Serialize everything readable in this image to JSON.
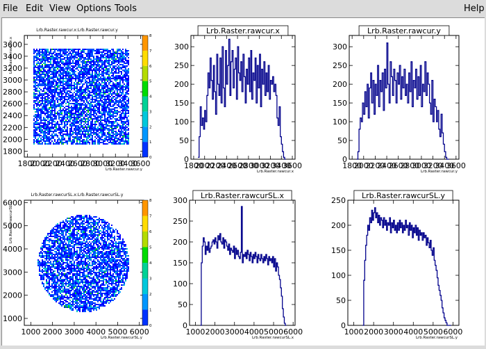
{
  "menubar": {
    "file": "File",
    "edit": "Edit",
    "view": "View",
    "options": "Options",
    "tools": "Tools",
    "help": "Help"
  },
  "colors": {
    "hist_line": "#00008b",
    "palette": [
      "#3c00c8",
      "#0032ff",
      "#0096ff",
      "#00c8dc",
      "#00d296",
      "#00dc00",
      "#b4dc00",
      "#ffdc00",
      "#ff9600",
      "#ff0000"
    ]
  },
  "chart_data": [
    {
      "id": "p1",
      "type": "heatmap",
      "title": "Lrb.Raster.rawcur.x:Lrb.Raster.rawcur.y",
      "xlabel": "Lrb.Raster.rawcur.y",
      "ylabel": "Lrb.Raster.rawcur.x",
      "xlim": [
        1750,
        3650
      ],
      "ylim": [
        1700,
        3750
      ],
      "xticks": [
        1800,
        2000,
        2200,
        2400,
        2600,
        2800,
        3000,
        3200,
        3400,
        3600
      ],
      "yticks": [
        1800,
        2000,
        2200,
        2400,
        2600,
        2800,
        3000,
        3200,
        3400,
        3600
      ],
      "xtick_labels": [
        "1800",
        "2000",
        "2200",
        "2400",
        "2600",
        "2800",
        "3000",
        "3200",
        "3400",
        "3600"
      ],
      "ytick_labels": [
        "1800",
        "2000",
        "2200",
        "2400",
        "2600",
        "2800",
        "3000",
        "3200",
        "3400",
        "3600"
      ],
      "zlim": [
        0,
        8
      ],
      "zticks": [
        0,
        1,
        2,
        3,
        4,
        5,
        6,
        7,
        8
      ],
      "zlabels": [
        "0",
        "1",
        "2",
        "3",
        "4",
        "5",
        "6",
        "7",
        "8"
      ],
      "shape": "square",
      "region_x": [
        1880,
        3400
      ],
      "region_y": [
        1920,
        3540
      ]
    },
    {
      "id": "p2",
      "type": "line",
      "title": "Lrb.Raster.rawcur.x",
      "xlabel": "Lrb.Raster.rawcur.x",
      "xlim": [
        1750,
        3650
      ],
      "ylim": [
        0,
        330
      ],
      "xticks": [
        1800,
        2000,
        2200,
        2400,
        2600,
        2800,
        3000,
        3200,
        3400,
        3600
      ],
      "xtick_labels": [
        "1800",
        "2000",
        "2200",
        "2400",
        "2600",
        "2800",
        "3000",
        "3200",
        "3400",
        "3600"
      ],
      "yticks": [
        0,
        50,
        100,
        150,
        200,
        250,
        300
      ],
      "ytick_labels": [
        "0",
        "50",
        "100",
        "150",
        "200",
        "250",
        "300"
      ],
      "x": [
        1880,
        1900,
        1920,
        1940,
        1960,
        1980,
        2000,
        2020,
        2040,
        2060,
        2080,
        2100,
        2120,
        2140,
        2160,
        2180,
        2200,
        2220,
        2240,
        2260,
        2280,
        2300,
        2320,
        2340,
        2360,
        2380,
        2400,
        2420,
        2440,
        2460,
        2480,
        2500,
        2520,
        2540,
        2560,
        2580,
        2600,
        2620,
        2640,
        2660,
        2680,
        2700,
        2720,
        2740,
        2760,
        2780,
        2800,
        2820,
        2840,
        2860,
        2880,
        2900,
        2920,
        2940,
        2960,
        2980,
        3000,
        3020,
        3040,
        3060,
        3080,
        3100,
        3120,
        3140,
        3160,
        3180,
        3200,
        3220,
        3240,
        3260,
        3280,
        3300,
        3320,
        3340,
        3360,
        3380,
        3400,
        3420,
        3440,
        3460
      ],
      "y": [
        5,
        60,
        140,
        90,
        110,
        80,
        130,
        100,
        170,
        230,
        190,
        270,
        210,
        160,
        250,
        180,
        120,
        280,
        200,
        170,
        270,
        150,
        300,
        190,
        140,
        290,
        200,
        250,
        320,
        170,
        260,
        290,
        190,
        240,
        270,
        160,
        300,
        230,
        210,
        260,
        180,
        280,
        220,
        150,
        240,
        200,
        270,
        180,
        290,
        160,
        230,
        210,
        270,
        150,
        250,
        190,
        280,
        140,
        240,
        200,
        260,
        170,
        230,
        180,
        250,
        160,
        210,
        200,
        220,
        180,
        200,
        170,
        110,
        90,
        140,
        60,
        40,
        20,
        5,
        0
      ]
    },
    {
      "id": "p3",
      "type": "line",
      "title": "Lrb.Raster.rawcur.y",
      "xlabel": "Lrb.Raster.rawcur.y",
      "xlim": [
        1750,
        3650
      ],
      "ylim": [
        0,
        330
      ],
      "xticks": [
        1800,
        2000,
        2200,
        2400,
        2600,
        2800,
        3000,
        3200,
        3400,
        3600
      ],
      "xtick_labels": [
        "1800",
        "2000",
        "2200",
        "2400",
        "2600",
        "2800",
        "3000",
        "3200",
        "3400",
        "3600"
      ],
      "yticks": [
        0,
        50,
        100,
        150,
        200,
        250,
        300
      ],
      "ytick_labels": [
        "0",
        "50",
        "100",
        "150",
        "200",
        "250",
        "300"
      ],
      "x": [
        1880,
        1900,
        1920,
        1940,
        1960,
        1980,
        2000,
        2020,
        2040,
        2060,
        2080,
        2100,
        2120,
        2140,
        2160,
        2180,
        2200,
        2220,
        2240,
        2260,
        2280,
        2300,
        2320,
        2340,
        2360,
        2380,
        2400,
        2420,
        2440,
        2460,
        2480,
        2500,
        2520,
        2540,
        2560,
        2580,
        2600,
        2620,
        2640,
        2660,
        2680,
        2700,
        2720,
        2740,
        2760,
        2780,
        2800,
        2820,
        2840,
        2860,
        2880,
        2900,
        2920,
        2940,
        2960,
        2980,
        3000,
        3020,
        3040,
        3060,
        3080,
        3100,
        3120,
        3140,
        3160,
        3180,
        3200,
        3220,
        3240,
        3260,
        3280,
        3300,
        3320,
        3340,
        3360,
        3380,
        3400,
        3420,
        3440,
        3460
      ],
      "y": [
        0,
        20,
        80,
        110,
        100,
        150,
        120,
        180,
        140,
        200,
        110,
        190,
        230,
        150,
        210,
        120,
        200,
        170,
        250,
        140,
        210,
        180,
        230,
        130,
        240,
        190,
        310,
        200,
        150,
        260,
        220,
        170,
        240,
        210,
        150,
        230,
        200,
        250,
        160,
        220,
        190,
        240,
        170,
        200,
        150,
        230,
        180,
        260,
        140,
        210,
        190,
        240,
        160,
        220,
        170,
        250,
        140,
        200,
        180,
        260,
        170,
        230,
        200,
        150,
        120,
        210,
        100,
        160,
        140,
        100,
        130,
        80,
        60,
        120,
        70,
        40,
        20,
        5,
        0,
        0
      ]
    },
    {
      "id": "p4",
      "type": "heatmap",
      "title": "Lrb.Raster.rawcurSL.x:Lrb.Raster.rawcurSL.y",
      "xlabel": "Lrb.Raster.rawcurSL.y",
      "ylabel": "Lrb.Raster.rawcurSL.x",
      "xlim": [
        700,
        6200
      ],
      "ylim": [
        700,
        6100
      ],
      "xticks": [
        1000,
        2000,
        3000,
        4000,
        5000,
        6000
      ],
      "yticks": [
        1000,
        2000,
        3000,
        4000,
        5000,
        6000
      ],
      "xtick_labels": [
        "1000",
        "2000",
        "3000",
        "4000",
        "5000",
        "6000"
      ],
      "ytick_labels": [
        "1000",
        "2000",
        "3000",
        "4000",
        "5000",
        "6000"
      ],
      "zlim": [
        0,
        8
      ],
      "zticks": [
        0,
        1,
        2,
        3,
        4,
        5,
        6,
        7,
        8
      ],
      "zlabels": [
        "0",
        "1",
        "2",
        "3",
        "4",
        "5",
        "6",
        "7",
        "8"
      ],
      "shape": "circle",
      "center": [
        3400,
        3400
      ],
      "radius": 2100
    },
    {
      "id": "p5",
      "type": "line",
      "title": "Lrb.Raster.rawcurSL.x",
      "xlabel": "Lrb.Raster.rawcurSL.x",
      "xlim": [
        700,
        6100
      ],
      "ylim": [
        0,
        300
      ],
      "xticks": [
        1000,
        2000,
        3000,
        4000,
        5000,
        6000
      ],
      "xtick_labels": [
        "1000",
        "2000",
        "3000",
        "4000",
        "5000",
        "6000"
      ],
      "yticks": [
        0,
        50,
        100,
        150,
        200,
        250,
        300
      ],
      "ytick_labels": [
        "0",
        "50",
        "100",
        "150",
        "200",
        "250",
        "300"
      ],
      "x": [
        1250,
        1300,
        1350,
        1400,
        1450,
        1500,
        1550,
        1600,
        1650,
        1700,
        1750,
        1800,
        1850,
        1900,
        1950,
        2000,
        2050,
        2100,
        2150,
        2200,
        2250,
        2300,
        2350,
        2400,
        2450,
        2500,
        2550,
        2600,
        2650,
        2700,
        2750,
        2800,
        2850,
        2900,
        2950,
        3000,
        3050,
        3100,
        3150,
        3200,
        3250,
        3300,
        3350,
        3400,
        3450,
        3500,
        3550,
        3600,
        3650,
        3700,
        3750,
        3800,
        3850,
        3900,
        3950,
        4000,
        4050,
        4100,
        4150,
        4200,
        4250,
        4300,
        4350,
        4400,
        4450,
        4500,
        4550,
        4600,
        4650,
        4700,
        4750,
        4800,
        4850,
        4900,
        4950,
        5000,
        5050,
        5100,
        5150,
        5200,
        5250,
        5300,
        5350,
        5400,
        5450,
        5500,
        5550,
        5600
      ],
      "y": [
        0,
        150,
        190,
        210,
        200,
        170,
        190,
        180,
        200,
        175,
        185,
        190,
        200,
        205,
        195,
        210,
        200,
        185,
        215,
        205,
        220,
        200,
        195,
        210,
        185,
        205,
        200,
        190,
        180,
        195,
        170,
        185,
        180,
        175,
        190,
        160,
        185,
        170,
        180,
        165,
        160,
        175,
        285,
        150,
        170,
        165,
        175,
        160,
        180,
        170,
        155,
        175,
        165,
        150,
        170,
        160,
        175,
        165,
        150,
        170,
        160,
        155,
        170,
        160,
        150,
        165,
        155,
        170,
        160,
        145,
        165,
        155,
        160,
        150,
        165,
        140,
        160,
        130,
        150,
        140,
        120,
        110,
        90,
        70,
        40,
        20,
        5,
        0
      ]
    },
    {
      "id": "p6",
      "type": "line",
      "title": "Lrb.Raster.rawcurSL.y",
      "xlabel": "Lrb.Raster.rawcurSL.y",
      "xlim": [
        700,
        6300
      ],
      "ylim": [
        0,
        250
      ],
      "xticks": [
        1000,
        2000,
        3000,
        4000,
        5000,
        6000
      ],
      "xtick_labels": [
        "1000",
        "2000",
        "3000",
        "4000",
        "5000",
        "6000"
      ],
      "yticks": [
        0,
        50,
        100,
        150,
        200,
        250
      ],
      "ytick_labels": [
        "0",
        "50",
        "100",
        "150",
        "200",
        "250"
      ],
      "x": [
        1450,
        1500,
        1550,
        1600,
        1650,
        1700,
        1750,
        1800,
        1850,
        1900,
        1950,
        2000,
        2050,
        2100,
        2150,
        2200,
        2250,
        2300,
        2350,
        2400,
        2450,
        2500,
        2550,
        2600,
        2650,
        2700,
        2750,
        2800,
        2850,
        2900,
        2950,
        3000,
        3050,
        3100,
        3150,
        3200,
        3250,
        3300,
        3350,
        3400,
        3450,
        3500,
        3550,
        3600,
        3650,
        3700,
        3750,
        3800,
        3850,
        3900,
        3950,
        4000,
        4050,
        4100,
        4150,
        4200,
        4250,
        4300,
        4350,
        4400,
        4450,
        4500,
        4550,
        4600,
        4650,
        4700,
        4750,
        4800,
        4850,
        4900,
        4950,
        5000,
        5050,
        5100,
        5150,
        5200,
        5250,
        5300,
        5350,
        5400,
        5450,
        5500,
        5550,
        5600,
        5650,
        5700,
        5750,
        5800,
        5850
      ],
      "y": [
        0,
        90,
        130,
        160,
        180,
        200,
        190,
        215,
        205,
        230,
        210,
        225,
        235,
        215,
        225,
        205,
        220,
        200,
        215,
        210,
        195,
        215,
        200,
        210,
        190,
        205,
        200,
        215,
        185,
        205,
        195,
        210,
        190,
        200,
        185,
        205,
        190,
        210,
        195,
        205,
        185,
        200,
        190,
        210,
        195,
        200,
        180,
        205,
        190,
        200,
        175,
        195,
        185,
        200,
        180,
        195,
        170,
        190,
        180,
        185,
        170,
        185,
        175,
        180,
        160,
        175,
        165,
        155,
        170,
        150,
        140,
        155,
        130,
        120,
        110,
        95,
        80,
        70,
        60,
        50,
        35,
        25,
        15,
        10,
        5,
        0,
        0,
        0,
        0
      ]
    }
  ]
}
